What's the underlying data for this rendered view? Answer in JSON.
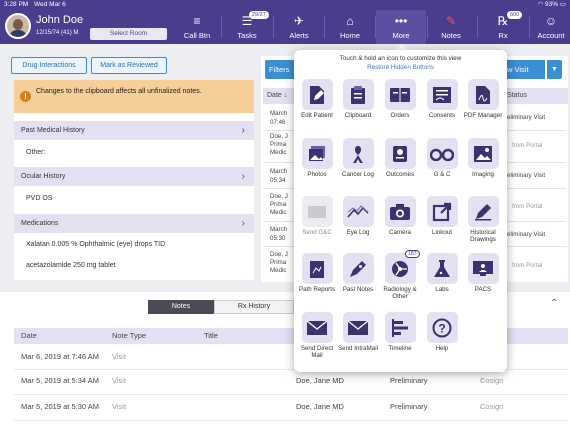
{
  "status_bar": {
    "time": "3:28 PM",
    "date": "Wed Mar 6",
    "battery": "93%"
  },
  "header": {
    "patient_name": "John Doe",
    "patient_dob": "12/15/74 (41) M",
    "select_room": "Select Room",
    "nav": [
      {
        "label": "Call Btn",
        "icon": "call-button-icon",
        "badge": ""
      },
      {
        "label": "Tasks",
        "icon": "tasks-icon",
        "badge": "29/27"
      },
      {
        "label": "Alerts",
        "icon": "alerts-icon",
        "badge": ""
      },
      {
        "label": "Home",
        "icon": "home-icon",
        "badge": ""
      },
      {
        "label": "More",
        "icon": "more-icon",
        "badge": ""
      },
      {
        "label": "Notes",
        "icon": "notes-icon",
        "badge": ""
      },
      {
        "label": "Rx",
        "icon": "rx-icon",
        "badge": "600"
      },
      {
        "label": "Account",
        "icon": "account-icon",
        "badge": ""
      }
    ]
  },
  "left": {
    "drug_interactions": "Drug Interactions",
    "mark_reviewed": "Mark as Reviewed",
    "warning": "Changes to the clipboard affects all unfinalized notes.",
    "past_medical_history": "Past Medical History",
    "pmh_value": "Other:",
    "ocular_history": "Ocular History",
    "ocular_value": "PVD OS",
    "medications": "Medications",
    "med_1": "Xalatan 0.005 % Ophthalmic (eye) drops TID",
    "med_2": "acetazolamide 250 mg tablet"
  },
  "right": {
    "filters": "Filters",
    "new_visit": "w Visit",
    "date_col": "Date",
    "status_col": "Status",
    "rows": [
      {
        "date": "March",
        "time": "07:46",
        "status": "eliminary Visit"
      },
      {
        "date": "",
        "time": "",
        "who": "Doe, J",
        "who2": "Prima",
        "who3": "Medic",
        "status": "from Portal"
      },
      {
        "date": "March",
        "time": "05:34",
        "status": "eliminary Visit"
      },
      {
        "date": "",
        "time": "",
        "who": "Doe, J",
        "who2": "Prima",
        "who3": "Medic",
        "status": "from Portal"
      },
      {
        "date": "March",
        "time": "05:30",
        "status": "eliminary Visit"
      },
      {
        "date": "",
        "time": "",
        "who": "Doe, J",
        "who2": "Prima",
        "who3": "Medic",
        "status": "from Portal"
      }
    ]
  },
  "popover": {
    "hint": "Touch & hold an icon to customize this view",
    "restore": "Restore Hidden Buttons",
    "tiles": [
      {
        "label": "Edit Patient",
        "icon": "edit-patient-icon",
        "badge": "",
        "disabled": false
      },
      {
        "label": "Clipboard",
        "icon": "clipboard-icon",
        "badge": "",
        "disabled": false
      },
      {
        "label": "Orders",
        "icon": "orders-icon",
        "badge": "",
        "disabled": false
      },
      {
        "label": "Consents",
        "icon": "consents-icon",
        "badge": "",
        "disabled": false
      },
      {
        "label": "PDF Manager",
        "icon": "pdf-manager-icon",
        "badge": "",
        "disabled": false
      },
      {
        "label": "Photos",
        "icon": "photos-icon",
        "badge": "",
        "disabled": false
      },
      {
        "label": "Cancer Log",
        "icon": "cancer-ribbon-icon",
        "badge": "",
        "disabled": false
      },
      {
        "label": "Outcomes",
        "icon": "outcomes-icon",
        "badge": "",
        "disabled": false
      },
      {
        "label": "G & C",
        "icon": "glasses-icon",
        "badge": "",
        "disabled": false
      },
      {
        "label": "Imaging",
        "icon": "imaging-icon",
        "badge": "",
        "disabled": false
      },
      {
        "label": "Send G&C",
        "icon": "send-gc-icon",
        "badge": "",
        "disabled": true
      },
      {
        "label": "Eye Log",
        "icon": "eye-log-icon",
        "badge": "",
        "disabled": false
      },
      {
        "label": "Camera",
        "icon": "camera-icon",
        "badge": "",
        "disabled": false
      },
      {
        "label": "Linkout",
        "icon": "linkout-icon",
        "badge": "",
        "disabled": false
      },
      {
        "label": "Historical Drawings",
        "icon": "historical-drawings-icon",
        "badge": "",
        "disabled": false
      },
      {
        "label": "Path Reports",
        "icon": "path-reports-icon",
        "badge": "",
        "disabled": false
      },
      {
        "label": "Past Notes",
        "icon": "past-notes-icon",
        "badge": "",
        "disabled": false
      },
      {
        "label": "Radiology & Other",
        "icon": "radiology-icon",
        "badge": "187",
        "disabled": false
      },
      {
        "label": "Labs",
        "icon": "labs-icon",
        "badge": "",
        "disabled": false
      },
      {
        "label": "PACS",
        "icon": "pacs-icon",
        "badge": "",
        "disabled": false
      },
      {
        "label": "Send Direct Mail",
        "icon": "direct-mail-icon",
        "badge": "",
        "disabled": false
      },
      {
        "label": "Send IntraMail",
        "icon": "intramail-icon",
        "badge": "",
        "disabled": false
      },
      {
        "label": "Timeline",
        "icon": "timeline-icon",
        "badge": "",
        "disabled": false
      },
      {
        "label": "Help",
        "icon": "help-icon",
        "badge": "",
        "disabled": false
      }
    ]
  },
  "bottom": {
    "tab_notes": "Notes",
    "tab_rx": "Rx History",
    "columns": {
      "date": "Date",
      "note_type": "Note Type",
      "title": "Title"
    },
    "rows": [
      {
        "date": "Mar 6, 2019 at 7:46 AM",
        "type": "Visit",
        "provider": "",
        "status": "",
        "action": ""
      },
      {
        "date": "Mar 5, 2019 at 5:34 AM",
        "type": "Visit",
        "provider": "Doe, Jane MD",
        "status": "Preliminary",
        "action": "Cosign"
      },
      {
        "date": "Mar 5, 2019 at 5:30 AM",
        "type": "Visit",
        "provider": "Doe, Jane MD",
        "status": "Preliminary",
        "action": "Cosign"
      }
    ]
  }
}
